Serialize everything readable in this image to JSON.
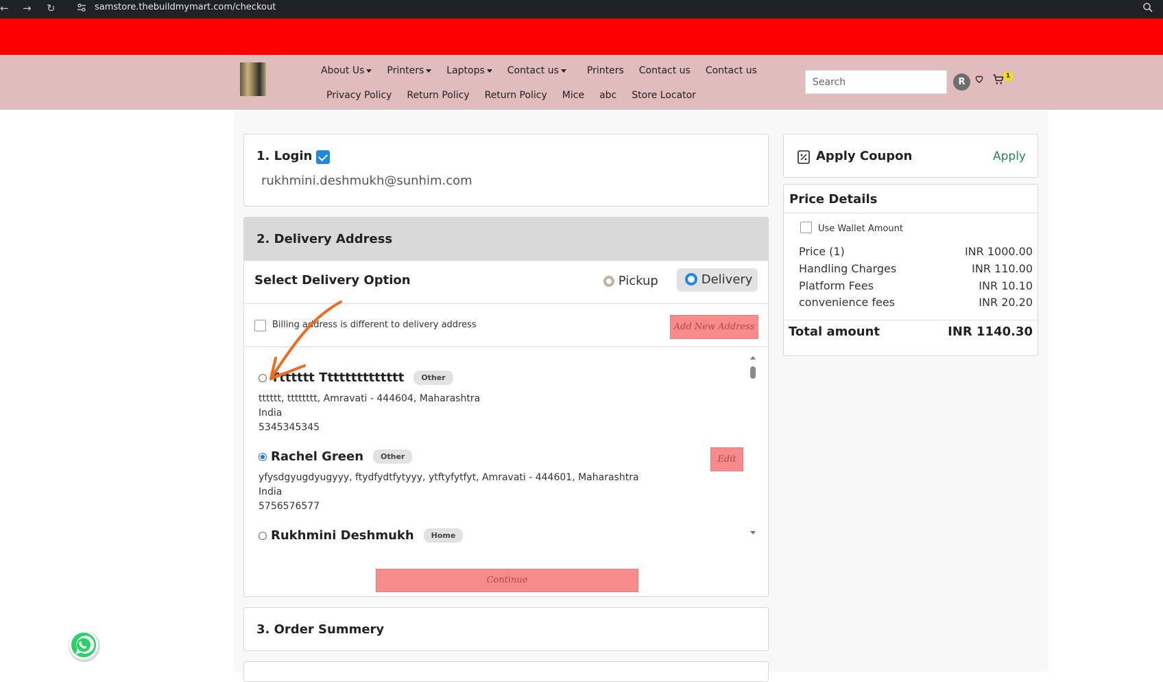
{
  "browser": {
    "url": "samstore.thebuildmymart.com/checkout",
    "back_icon": "arrow-left-icon",
    "forward_icon": "arrow-right-icon",
    "reload_icon": "reload-icon",
    "zoom_icon": "zoom-icon"
  },
  "nav": {
    "row1": [
      {
        "label": "About Us",
        "dropdown": true
      },
      {
        "label": "Printers",
        "dropdown": true
      },
      {
        "label": "Laptops",
        "dropdown": true
      },
      {
        "label": "Contact us",
        "dropdown": true
      },
      {
        "label": "Printers",
        "dropdown": false
      },
      {
        "label": "Contact us",
        "dropdown": false
      },
      {
        "label": "Contact us",
        "dropdown": false
      }
    ],
    "row2": [
      {
        "label": "Privacy Policy"
      },
      {
        "label": "Return Policy"
      },
      {
        "label": "Return Policy"
      },
      {
        "label": "Mice"
      },
      {
        "label": "abc"
      },
      {
        "label": "Store Locator"
      }
    ],
    "search_placeholder": "Search",
    "avatar_initial": "R",
    "cart_count": "1"
  },
  "login": {
    "title": "1. Login",
    "email": "rukhmini.deshmukh@sunhim.com"
  },
  "delivery": {
    "title": "2. Delivery Address",
    "option_label": "Select Delivery Option",
    "pickup_label": "Pickup",
    "delivery_label": "Delivery",
    "selected_option": "Delivery",
    "billing_label": "Billing address is different to delivery address",
    "add_new_label": "Add New Address",
    "addresses": [
      {
        "name": "Ttttttt Tttttttttttttt",
        "tag": "Other",
        "line1": "tttttt, tttttttt, Amravati - 444604, Maharashtra",
        "country": "India",
        "phone": "5345345345",
        "selected": false
      },
      {
        "name": "Rachel Green",
        "tag": "Other",
        "line1": "yfysdgyugdyugyyy, ftydfydtfytyyy, ytftyfytfyt, Amravati - 444601, Maharashtra",
        "country": "India",
        "phone": "5756576577",
        "selected": true,
        "edit_label": "Edit"
      },
      {
        "name": "Rukhmini Deshmukh",
        "tag": "Home",
        "selected": false
      }
    ],
    "continue_label": "Continue"
  },
  "order_summary": {
    "title": "3. Order Summery"
  },
  "coupon": {
    "title": "Apply Coupon",
    "apply_label": "Apply",
    "icon": "coupon-icon"
  },
  "price_details": {
    "title": "Price Details",
    "wallet_label": "Use Wallet Amount",
    "rows": [
      {
        "label": "Price (1)",
        "value": "INR 1000.00"
      },
      {
        "label": "Handling Charges",
        "value": "INR 110.00"
      },
      {
        "label": "Platform Fees",
        "value": "INR 10.10"
      },
      {
        "label": "convenience fees",
        "value": "INR 20.20"
      }
    ],
    "total_label": "Total amount",
    "total_value": "INR 1140.30"
  },
  "colors": {
    "banner": "#ff0000",
    "header": "#e0bcbc",
    "accent_blue": "#1e88e5",
    "button_pink": "#f78b8b",
    "apply_green": "#1f8a4c",
    "annotation_arrow": "#f26b1d"
  }
}
